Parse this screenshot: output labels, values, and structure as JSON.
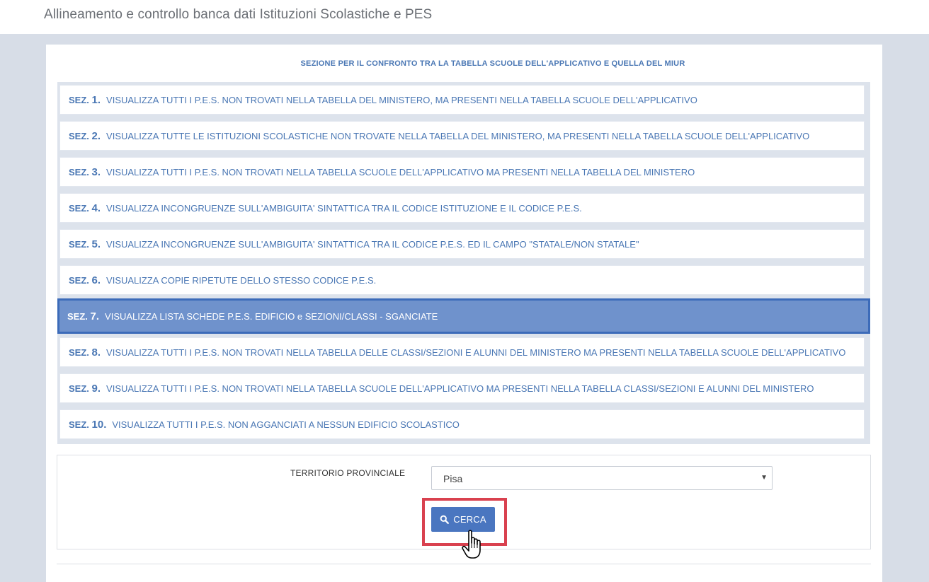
{
  "header": {
    "title": "Allineamento e controllo banca dati Istituzioni Scolastiche e PES"
  },
  "section_header": "SEZIONE PER IL CONFRONTO TRA LA TABELLA SCUOLE DELL'APPLICATIVO E QUELLA DEL MIUR",
  "sections": [
    {
      "prefix": "SEZ.",
      "number": "1.",
      "text": "VISUALIZZA TUTTI I P.E.S. NON TROVATI NELLA TABELLA DEL MINISTERO, MA PRESENTI NELLA TABELLA SCUOLE DELL'APPLICATIVO"
    },
    {
      "prefix": "SEZ.",
      "number": "2.",
      "text": "VISUALIZZA TUTTE LE ISTITUZIONI SCOLASTICHE NON TROVATE NELLA TABELLA DEL MINISTERO, MA PRESENTI NELLA TABELLA SCUOLE DELL'APPLICATIVO"
    },
    {
      "prefix": "SEZ.",
      "number": "3.",
      "text": "VISUALIZZA TUTTI I P.E.S. NON TROVATI NELLA TABELLA SCUOLE DELL'APPLICATIVO MA PRESENTI NELLA TABELLA DEL MINISTERO"
    },
    {
      "prefix": "SEZ.",
      "number": "4.",
      "text": "VISUALIZZA INCONGRUENZE SULL'AMBIGUITA' SINTATTICA TRA IL CODICE ISTITUZIONE E IL CODICE P.E.S."
    },
    {
      "prefix": "SEZ.",
      "number": "5.",
      "text": "VISUALIZZA INCONGRUENZE SULL'AMBIGUITA' SINTATTICA TRA IL CODICE P.E.S. ED IL CAMPO \"STATALE/NON STATALE\""
    },
    {
      "prefix": "SEZ.",
      "number": "6.",
      "text": "VISUALIZZA COPIE RIPETUTE DELLO STESSO CODICE P.E.S."
    },
    {
      "prefix": "SEZ.",
      "number": "7.",
      "text": "VISUALIZZA LISTA SCHEDE P.E.S. EDIFICIO e SEZIONI/CLASSI - SGANCIATE"
    },
    {
      "prefix": "SEZ.",
      "number": "8.",
      "text": "VISUALIZZA TUTTI I P.E.S. NON TROVATI NELLA TABELLA DELLE CLASSI/SEZIONI E ALUNNI DEL MINISTERO MA PRESENTI NELLA TABELLA SCUOLE DELL'APPLICATIVO"
    },
    {
      "prefix": "SEZ.",
      "number": "9.",
      "text": "VISUALIZZA TUTTI I P.E.S. NON TROVATI NELLA TABELLA SCUOLE DELL'APPLICATIVO MA PRESENTI NELLA TABELLA CLASSI/SEZIONI E ALUNNI DEL MINISTERO"
    },
    {
      "prefix": "SEZ.",
      "number": "10.",
      "text": "VISUALIZZA TUTTI I P.E.S. NON AGGANCIATI A NESSUN EDIFICIO SCOLASTICO"
    }
  ],
  "active_section": 7,
  "form": {
    "territory_label": "TERRITORIO PROVINCIALE",
    "territory_value": "Pisa",
    "search_label": "CERCA",
    "search_icon": "search-icon"
  },
  "colors": {
    "accent": "#4a76c0",
    "active_row": "#6f92cc",
    "link_text": "#4a77b4",
    "highlight": "#d9414f",
    "page_bg": "#d7dde7"
  }
}
